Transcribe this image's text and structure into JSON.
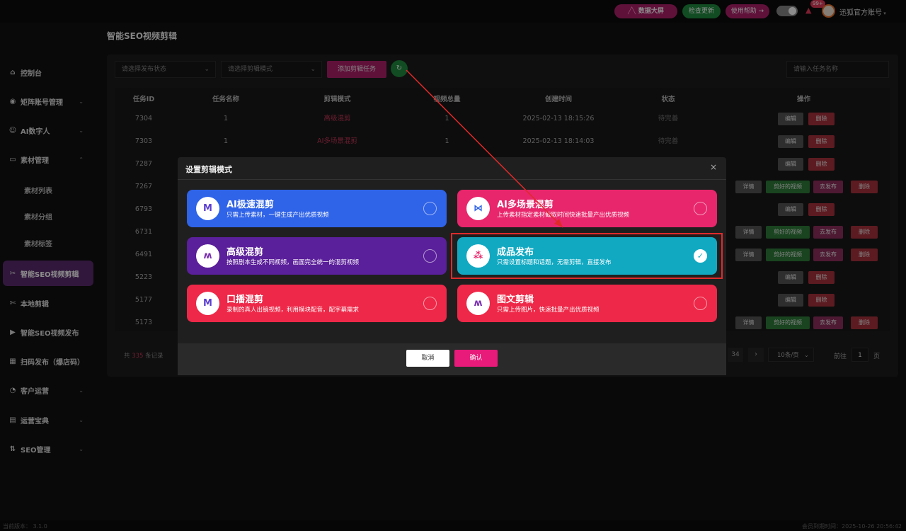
{
  "topbar": {
    "data_screen": "数据大屏",
    "check_update": "检查更新",
    "help": "使用帮助 →",
    "notif_count": "99+",
    "account": "迅狐官方账号"
  },
  "sidebar": {
    "items": [
      {
        "label": "控制台",
        "icon": "home-icon"
      },
      {
        "label": "矩阵账号管理",
        "icon": "account-icon"
      },
      {
        "label": "AI数字人",
        "icon": "ai-person-icon"
      },
      {
        "label": "素材管理",
        "icon": "folder-icon"
      },
      {
        "label": "素材列表"
      },
      {
        "label": "素材分组"
      },
      {
        "label": "素材标签"
      },
      {
        "label": "智能SEO视频剪辑",
        "icon": "scissors-icon"
      },
      {
        "label": "本地剪辑",
        "icon": "cut-icon"
      },
      {
        "label": "智能SEO视频发布",
        "icon": "video-icon"
      },
      {
        "label": "扫码发布（爆店码）",
        "icon": "qrcode-icon"
      },
      {
        "label": "客户运营",
        "icon": "customer-icon"
      },
      {
        "label": "运营宝典",
        "icon": "book-icon"
      },
      {
        "label": "SEO管理",
        "icon": "seo-icon"
      }
    ]
  },
  "page": {
    "title": "智能SEO视频剪辑"
  },
  "filters": {
    "status_placeholder": "请选择发布状态",
    "mode_placeholder": "请选择剪辑模式",
    "add_task": "添加剪辑任务",
    "search_placeholder": "请输入任务名称"
  },
  "table": {
    "headers": [
      "任务ID",
      "任务名称",
      "剪辑模式",
      "视频总量",
      "创建时间",
      "状态",
      "操作"
    ],
    "rows": [
      {
        "id": "7304",
        "name": "1",
        "mode": "高级混剪",
        "total": "1",
        "time": "2025-02-13 18:15:26",
        "status": "待完善"
      },
      {
        "id": "7303",
        "name": "1",
        "mode": "AI多场景混剪",
        "total": "1",
        "time": "2025-02-13 18:14:03",
        "status": "待完善"
      },
      {
        "id": "7287"
      },
      {
        "id": "7267"
      },
      {
        "id": "6793"
      },
      {
        "id": "6731"
      },
      {
        "id": "6491"
      },
      {
        "id": "5223"
      },
      {
        "id": "5177"
      },
      {
        "id": "5173"
      }
    ],
    "actions": {
      "edit": "编辑",
      "delete": "删除",
      "detail": "详情",
      "cut_video": "剪好的视频",
      "publish": "去发布"
    }
  },
  "pagination": {
    "total_prefix": "共",
    "total": "335",
    "total_suffix": "条记录",
    "last_page": "34",
    "next": "›",
    "page_size": "10条/页",
    "goto_label": "前往",
    "goto_value": "1",
    "goto_suffix": "页"
  },
  "modal": {
    "title": "设置剪辑模式",
    "close": "×",
    "options": [
      {
        "title": "AI极速混剪",
        "desc": "只需上传素材，一键生成产出优质视频",
        "color": "#2f63e8",
        "selected": false
      },
      {
        "title": "AI多场景混剪",
        "desc": "上传素材指定素材截取时间快速批量产出优质视频",
        "color": "#e8266b",
        "selected": false
      },
      {
        "title": "高级混剪",
        "desc": "按照剧本生成不同视频，画面完全统一的混剪视频",
        "color": "#5a1f9a",
        "selected": false
      },
      {
        "title": "成品发布",
        "desc": "只需设置标题和话题，无需剪辑，直接发布",
        "color": "#11a9c2",
        "selected": true
      },
      {
        "title": "口播混剪",
        "desc": "录制的真人出镜视频，利用模块配音，配字幕需求",
        "color": "#ee2848",
        "selected": false
      },
      {
        "title": "图文剪辑",
        "desc": "只需上传图片，快速批量产出优质视频",
        "color": "#ee2848",
        "selected": false
      }
    ],
    "cancel": "取消",
    "confirm": "确认"
  },
  "footer": {
    "version": "当前版本： 3.1.0",
    "expiry": "会员到期时间：2025-10-26 20:56:42"
  }
}
